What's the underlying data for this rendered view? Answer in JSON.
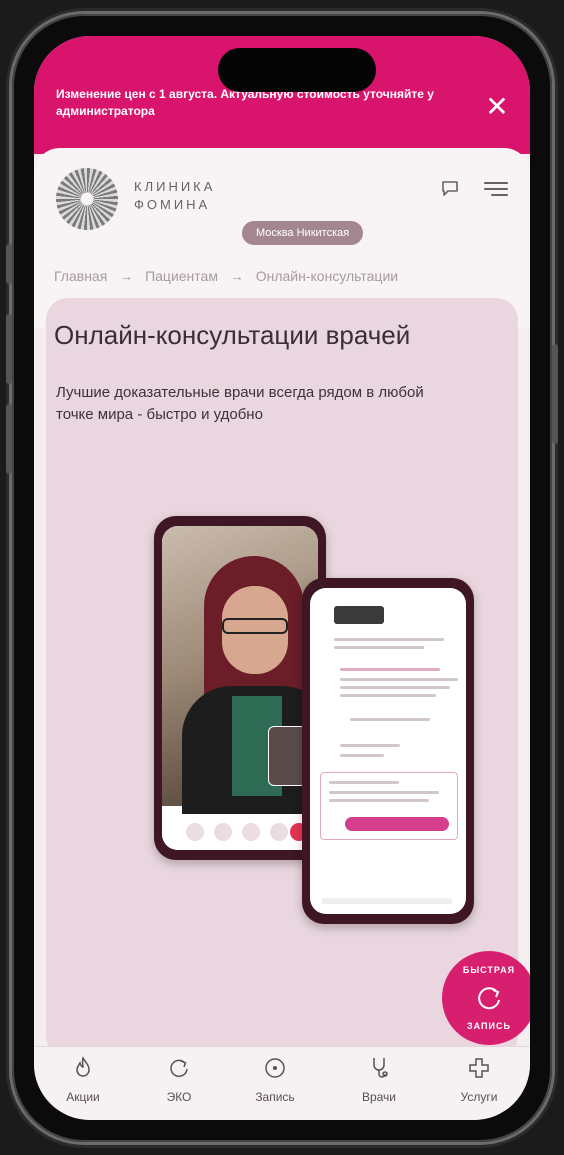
{
  "banner": {
    "text": "Изменение цен с 1 августа. Актуальную стоимость уточняйте у администратора",
    "close_label": "✕"
  },
  "header": {
    "logo_text": "КЛИНИКА\nФОМИНА",
    "branch": "Москва Никитская",
    "breadcrumb": [
      "Главная",
      "Пациентам",
      "Онлайн-консультации"
    ],
    "breadcrumb_sep": "→"
  },
  "hero": {
    "title": "Онлайн-консультации врачей",
    "subtitle": "Лучшие доказательные врачи всегда рядом в любой точке мира - быстро и удобно"
  },
  "fab": {
    "label_top": "БЫСТРАЯ",
    "label_bottom": "ЗАПИСЬ"
  },
  "tabbar": {
    "items": [
      {
        "label": "Акции",
        "icon": "flame-icon"
      },
      {
        "label": "ЭКО",
        "icon": "refresh-icon"
      },
      {
        "label": "Запись",
        "icon": "record-icon"
      },
      {
        "label": "Врачи",
        "icon": "stethoscope-icon"
      },
      {
        "label": "Услуги",
        "icon": "cross-icon"
      }
    ]
  },
  "colors": {
    "accent": "#d8146d",
    "panel": "#ead6df",
    "pill": "#a48693"
  }
}
